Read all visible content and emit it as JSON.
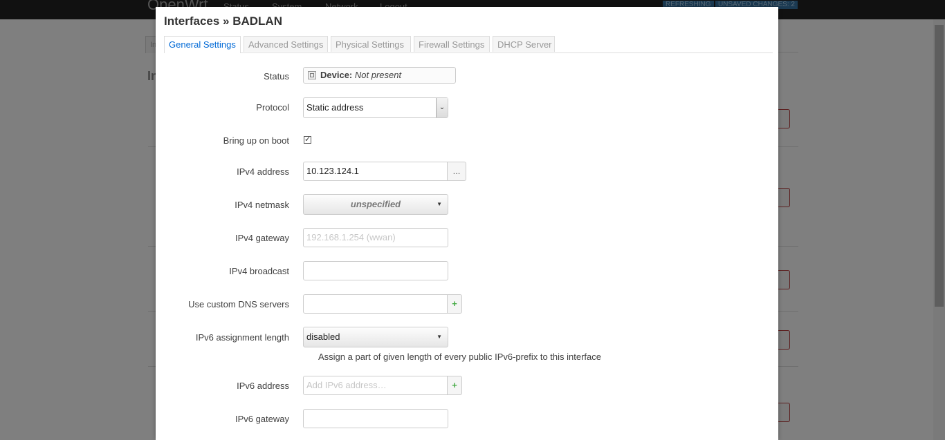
{
  "background": {
    "brand": "OpenWrt",
    "nav": [
      "Status",
      "System",
      "Network",
      "Logout"
    ],
    "badges": [
      "REFRESHING",
      "UNSAVED CHANGES: 2"
    ],
    "page_title": "In",
    "tab_stub": "In"
  },
  "modal": {
    "title": "Interfaces » BADLAN",
    "tabs": [
      {
        "label": "General Settings",
        "active": true
      },
      {
        "label": "Advanced Settings",
        "active": false
      },
      {
        "label": "Physical Settings",
        "active": false
      },
      {
        "label": "Firewall Settings",
        "active": false
      },
      {
        "label": "DHCP Server",
        "active": false
      }
    ],
    "status": {
      "label": "Status",
      "device_key": "Device:",
      "device_value": "Not present"
    },
    "protocol": {
      "label": "Protocol",
      "value": "Static address"
    },
    "boot": {
      "label": "Bring up on boot",
      "checked": true,
      "check_glyph": "✓"
    },
    "ipv4_address": {
      "label": "IPv4 address",
      "value": "10.123.124.1",
      "button": "..."
    },
    "ipv4_netmask": {
      "label": "IPv4 netmask",
      "value": "unspecified"
    },
    "ipv4_gateway": {
      "label": "IPv4 gateway",
      "placeholder": "192.168.1.254 (wwan)"
    },
    "ipv4_broadcast": {
      "label": "IPv4 broadcast",
      "value": ""
    },
    "dns": {
      "label": "Use custom DNS servers",
      "value": "",
      "add": "+"
    },
    "ipv6_assign": {
      "label": "IPv6 assignment length",
      "value": "disabled",
      "description": "Assign a part of given length of every public IPv6-prefix to this interface"
    },
    "ipv6_address": {
      "label": "IPv6 address",
      "placeholder": "Add IPv6 address…",
      "add": "+"
    },
    "ipv6_gateway": {
      "label": "IPv6 gateway",
      "value": ""
    }
  }
}
